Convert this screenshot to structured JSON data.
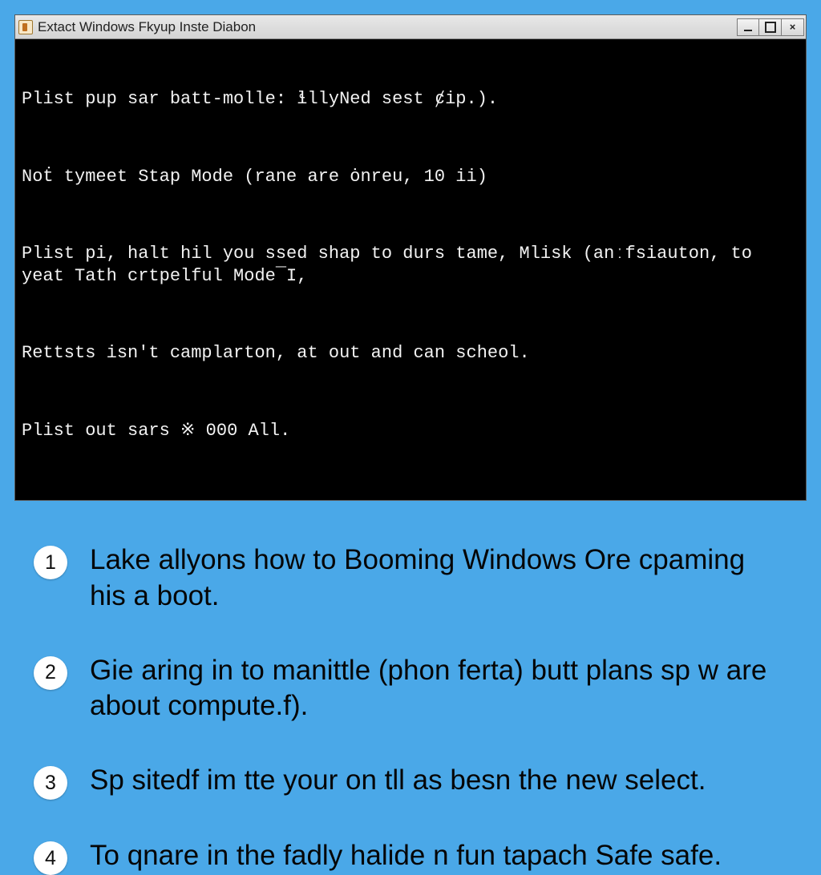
{
  "window": {
    "title": "Extact Windows Fkyup Inste Diabon",
    "terminal_lines": [
      "Plist pup sar batt-molle: ɬllyNed sest ȼip.).",
      "Noṫ tymeet Stap Mode (rane are ȯnreu, 10 ii)",
      "Plist pi, halt hil you ssed shap to durs tame, Mlisk (anːfsiauton, to yeat Tath crtpelful Mode¯I,",
      "Rettsts isn't camplarton, at out and can scheol.",
      "Plist out sars ※ 000 All."
    ]
  },
  "steps": [
    {
      "n": "1",
      "text": "Lake allyons how to Booming Windows Ore cpaming his a boot."
    },
    {
      "n": "2",
      "text": "Gie aring in to manittle (phon ferta) butt plans sp w are about compute.f)."
    },
    {
      "n": "3",
      "text": "Sp sitedf im tte your on tll as besn the new select."
    },
    {
      "n": "4",
      "text": "To qnare in the fadly halide n fun tapach Safe safe."
    }
  ]
}
